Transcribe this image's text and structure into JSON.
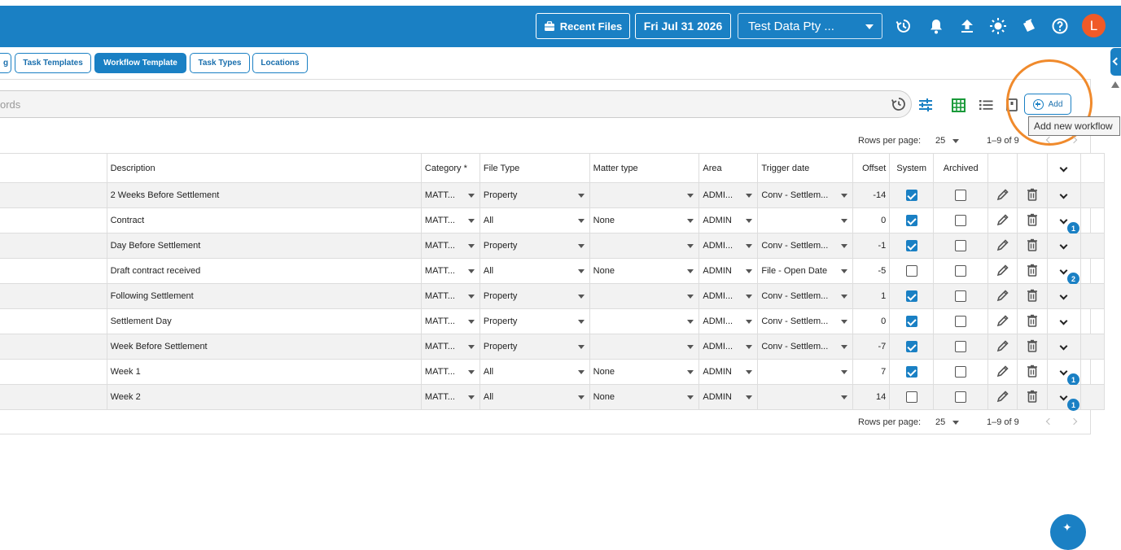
{
  "topbar": {
    "recent_files": "Recent Files",
    "date": "Fri Jul 31 2026",
    "company": "Test Data Pty ...",
    "avatar_initial": "L",
    "icons": [
      "history-icon",
      "bell-icon",
      "upload-icon",
      "sun-icon",
      "pages-icon",
      "help-icon"
    ]
  },
  "tabs": [
    {
      "label": "g",
      "active": false
    },
    {
      "label": "Task Templates",
      "active": false
    },
    {
      "label": "Workflow Template",
      "active": true
    },
    {
      "label": "Task Types",
      "active": false
    },
    {
      "label": "Locations",
      "active": false
    }
  ],
  "search": {
    "placeholder": "ords"
  },
  "toolbar": {
    "add_label": "Add",
    "tooltip": "Add new workflow"
  },
  "pagination": {
    "rows_label": "Rows per page:",
    "rows_value": "25",
    "range": "1–9 of 9"
  },
  "columns": [
    "Description",
    "Category *",
    "File Type",
    "Matter type",
    "Area",
    "Trigger date",
    "Offset",
    "System",
    "Archived"
  ],
  "rows": [
    {
      "description": "2 Weeks Before Settlement",
      "category": "MATT...",
      "file_type": "Property",
      "matter_type": "",
      "area": "ADMI...",
      "trigger": "Conv - Settlem...",
      "offset": "-14",
      "system": true,
      "archived": false,
      "badge": ""
    },
    {
      "description": "Contract",
      "category": "MATT...",
      "file_type": "All",
      "matter_type": "None",
      "area": "ADMIN",
      "trigger": "",
      "offset": "0",
      "system": true,
      "archived": false,
      "badge": "1"
    },
    {
      "description": "Day Before Settlement",
      "category": "MATT...",
      "file_type": "Property",
      "matter_type": "",
      "area": "ADMI...",
      "trigger": "Conv - Settlem...",
      "offset": "-1",
      "system": true,
      "archived": false,
      "badge": ""
    },
    {
      "description": "Draft contract received",
      "category": "MATT...",
      "file_type": "All",
      "matter_type": "None",
      "area": "ADMIN",
      "trigger": "File - Open Date",
      "offset": "-5",
      "system": false,
      "archived": false,
      "badge": "2"
    },
    {
      "description": "Following Settlement",
      "category": "MATT...",
      "file_type": "Property",
      "matter_type": "",
      "area": "ADMI...",
      "trigger": "Conv - Settlem...",
      "offset": "1",
      "system": true,
      "archived": false,
      "badge": ""
    },
    {
      "description": "Settlement Day",
      "category": "MATT...",
      "file_type": "Property",
      "matter_type": "",
      "area": "ADMI...",
      "trigger": "Conv - Settlem...",
      "offset": "0",
      "system": true,
      "archived": false,
      "badge": ""
    },
    {
      "description": "Week Before Settlement",
      "category": "MATT...",
      "file_type": "Property",
      "matter_type": "",
      "area": "ADMI...",
      "trigger": "Conv - Settlem...",
      "offset": "-7",
      "system": true,
      "archived": false,
      "badge": ""
    },
    {
      "description": "Week 1",
      "category": "MATT...",
      "file_type": "All",
      "matter_type": "None",
      "area": "ADMIN",
      "trigger": "",
      "offset": "7",
      "system": true,
      "archived": false,
      "badge": "1"
    },
    {
      "description": "Week 2",
      "category": "MATT...",
      "file_type": "All",
      "matter_type": "None",
      "area": "ADMIN",
      "trigger": "",
      "offset": "14",
      "system": false,
      "archived": false,
      "badge": "1"
    }
  ],
  "colors": {
    "primary": "#1a80c4",
    "avatar": "#f05a28",
    "highlight": "#f08a2c"
  }
}
